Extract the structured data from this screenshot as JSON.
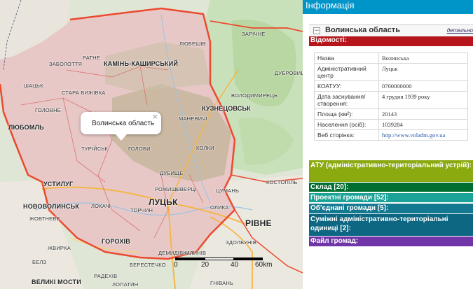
{
  "map": {
    "popup_text": "Волинська область",
    "close_symbol": "×",
    "labels": {
      "zarichne": "ЗАРІЧНЕ",
      "dubrovytsia": "ДУБРОВИЦЯ",
      "kamin": "КАМІНЬ-КАШИРСЬКИЙ",
      "zabolottia": "ЗАБОЛОТТЯ",
      "ratne": "РАТНЕ",
      "liubeshiv": "ЛЮБЕШІВ",
      "shatsk": "ШАЦЬК",
      "stara_vyzhivka": "СТАРА ВИЖІВКА",
      "volodymyrets": "ВОЛОДИМИРЕЦЬ",
      "holovne": "ГОЛОВНЕ",
      "kuznetsovsk": "КУЗНЕЦОВСЬК",
      "manevychi": "МАНЕВИЧІ",
      "liuboml": "ЛЮБОМЛЬ",
      "turiysk": "ТУРІЙСЬК",
      "holoby": "ГОЛОБИ",
      "kolky": "КОЛКИ",
      "ustyluh": "УСТИЛУГ",
      "dubyshche": "ДУБИЩЕ",
      "rozhyshche": "РОЖИЩЕ",
      "kivertsi": "КІВЕРЦІ",
      "tsuman": "ЦУМАНЬ",
      "kostopil": "КОСТОПІЛЬ",
      "novovolynsk": "НОВОВОЛИНСЬК",
      "lokachi": "ЛОКАЧІ",
      "torchyn": "ТОРЧИН",
      "olyka": "ОЛИКА",
      "lutsk": "ЛУЦЬК",
      "zhovtneve": "ЖОВТНЕВЕ",
      "rivne": "РІВНЕ",
      "horokhiv": "ГОРОХІВ",
      "zdolbuniv": "ЗДОЛБУНІВ",
      "zhvyrka": "ЖВИРКА",
      "radekhiv": "РАДЕХІВ",
      "demydivka": "ДЕМИДІВКА",
      "mlyniv": "МЛИНІВ",
      "belz": "БЕЛЗ",
      "berestechko": "БЕРЕСТЕЧКО",
      "velyki_mosty": "ВЕЛИКІ МОСТИ",
      "lopatyn": "ЛОПАТИН",
      "hnivan": "ГНІВАНЬ"
    },
    "scale": {
      "t0": "0",
      "t1": "20",
      "t2": "40",
      "t3": "60km"
    },
    "colors": {
      "region_fill": "#c8b8a0",
      "border": "#e63c2a",
      "forest": "#b7d39c"
    }
  },
  "panel": {
    "title": "Інформація",
    "oblast_name": "Волинська область",
    "oblast_link": "детально",
    "collapse_symbol": "−",
    "vidomosti": "Відомості:",
    "table": [
      {
        "k": "Назва",
        "v": "Волинська"
      },
      {
        "k": "Адміністративний центр",
        "v": "Луцьк"
      },
      {
        "k": "КОАТУУ:",
        "v": "0700000000"
      },
      {
        "k": "Дата заснування/ створення:",
        "v": "4 грудня 1939 року"
      },
      {
        "k": "Площа (км²):",
        "v": "20143"
      },
      {
        "k": "Населення (осіб):",
        "v": "1039284"
      },
      {
        "k": "Веб сторінка:",
        "v": "http://www.voladm.gov.ua"
      }
    ],
    "sections": {
      "ato": "АТУ (адміністративно-територіальний устрій):",
      "sklad": "Склад [20]:",
      "proj": "Проектні громади [52]:",
      "obed": "Об'єднані громади [5]:",
      "sumizh": "Суміжні адміністративно-територіальні одиниці [2]:",
      "fail": "Файл громад:"
    },
    "colors": {
      "header": "#0095c9",
      "vidomosti": "#b5151b",
      "ato": "#8aaa10",
      "sklad": "#006e2e",
      "proj": "#1aa396",
      "obed": "#147890",
      "sumizh": "#0d6782",
      "fail": "#7036a7"
    }
  }
}
